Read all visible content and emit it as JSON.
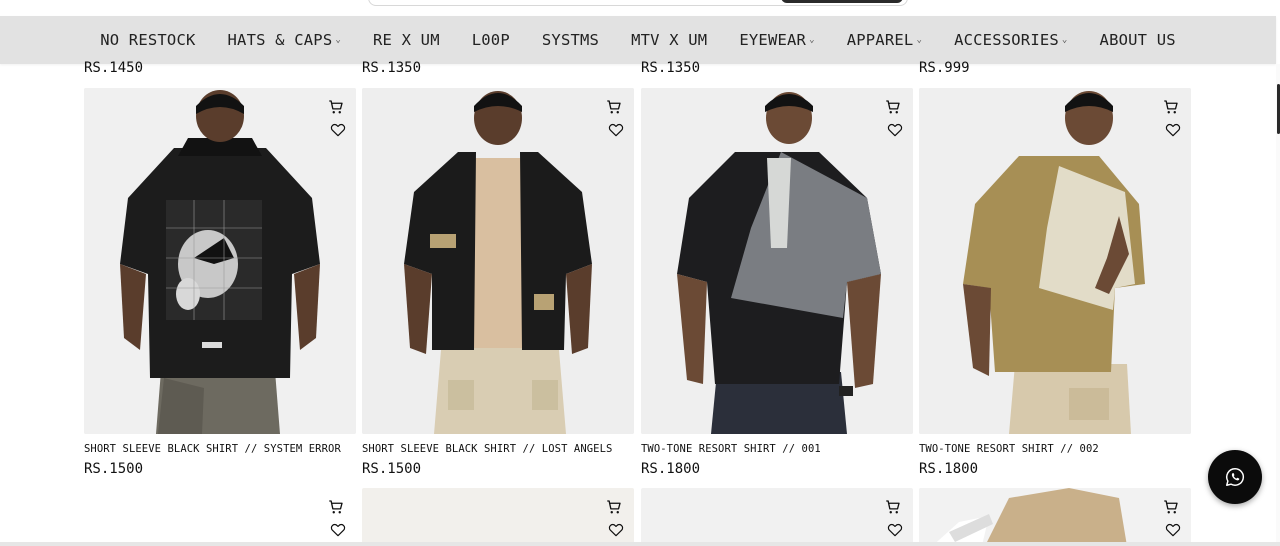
{
  "nav": {
    "items": [
      {
        "label": "NO RESTOCK",
        "has_dropdown": false
      },
      {
        "label": "HATS & CAPS",
        "has_dropdown": true
      },
      {
        "label": "RE X UM",
        "has_dropdown": false
      },
      {
        "label": "L00P",
        "has_dropdown": false
      },
      {
        "label": "SYSTMS",
        "has_dropdown": false
      },
      {
        "label": "MTV X UM",
        "has_dropdown": false
      },
      {
        "label": "EYEWEAR",
        "has_dropdown": true
      },
      {
        "label": "APPAREL",
        "has_dropdown": true
      },
      {
        "label": "ACCESSORIES",
        "has_dropdown": true
      },
      {
        "label": "ABOUT US",
        "has_dropdown": false
      }
    ],
    "chevron_glyph": "⌄"
  },
  "previous_row_prices": [
    "RS.1450",
    "RS.1350",
    "RS.1350",
    "RS.999"
  ],
  "products": [
    {
      "title": "SHORT SLEEVE BLACK SHIRT // SYSTEM ERROR",
      "price": "RS.1500"
    },
    {
      "title": "SHORT SLEEVE BLACK SHIRT // LOST ANGELS",
      "price": "RS.1500"
    },
    {
      "title": "TWO-TONE RESORT SHIRT // 001",
      "price": "RS.1800"
    },
    {
      "title": "TWO-TONE RESORT SHIRT // 002",
      "price": "RS.1800"
    }
  ],
  "icons": {
    "cart": "cart-icon",
    "wishlist": "heart-icon",
    "whatsapp": "whatsapp-icon"
  },
  "colors": {
    "nav_bg": "#e2e2e2",
    "text": "#111111",
    "whatsapp_btn": "#0b0b0b"
  }
}
